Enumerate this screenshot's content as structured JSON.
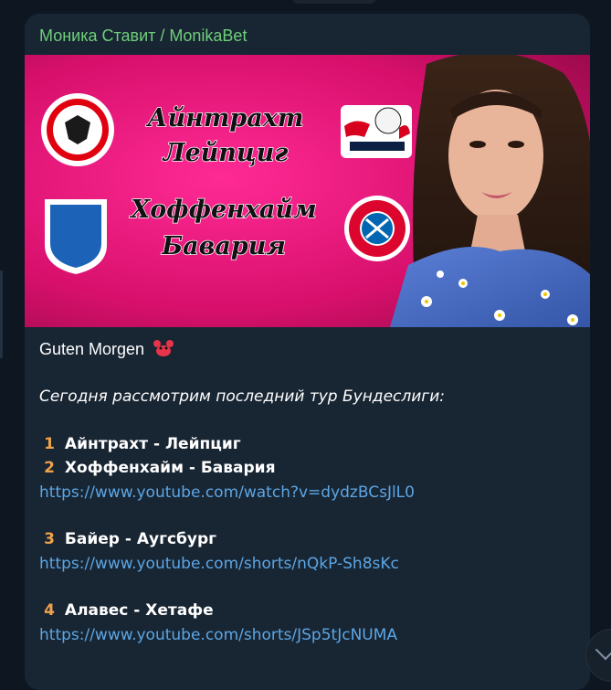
{
  "channel": {
    "name": "Моника Ставит / MonikaBet"
  },
  "banner": {
    "match1_team1": "Айнтрахт",
    "match1_team2": "Лейпциг",
    "match2_team1": "Хоффенхайм",
    "match2_team2": "Бавария",
    "badges": [
      "eintracht-crest-icon",
      "rb-leipzig-crest-icon",
      "hoffenheim-crest-icon",
      "bayern-crest-icon"
    ],
    "colors": {
      "background": "#d01068",
      "accent": "#ff1c8c"
    }
  },
  "post": {
    "greeting": "Guten Morgen",
    "greeting_icon": "crab-emoji-icon",
    "intro": "Сегодня рассмотрим последний тур Бундеслиги:",
    "items": [
      {
        "number": "1",
        "match": "Айнтрахт - Лейпциг"
      },
      {
        "number": "2",
        "match": "Хоффенхайм - Бавария",
        "link": "https://www.youtube.com/watch?v=dydzBCsJlL0"
      },
      {
        "number": "3",
        "match": "Байер - Аугсбург",
        "link": "https://www.youtube.com/shorts/nQkP-Sh8sKc"
      },
      {
        "number": "4",
        "match": "Алавес - Хетафе",
        "link": "https://www.youtube.com/shorts/JSp5tJcNUMA"
      }
    ]
  },
  "colors": {
    "link": "#5ca6e4",
    "sender": "#6fcf7a",
    "bubble": "#182533",
    "background": "#0e1621"
  }
}
